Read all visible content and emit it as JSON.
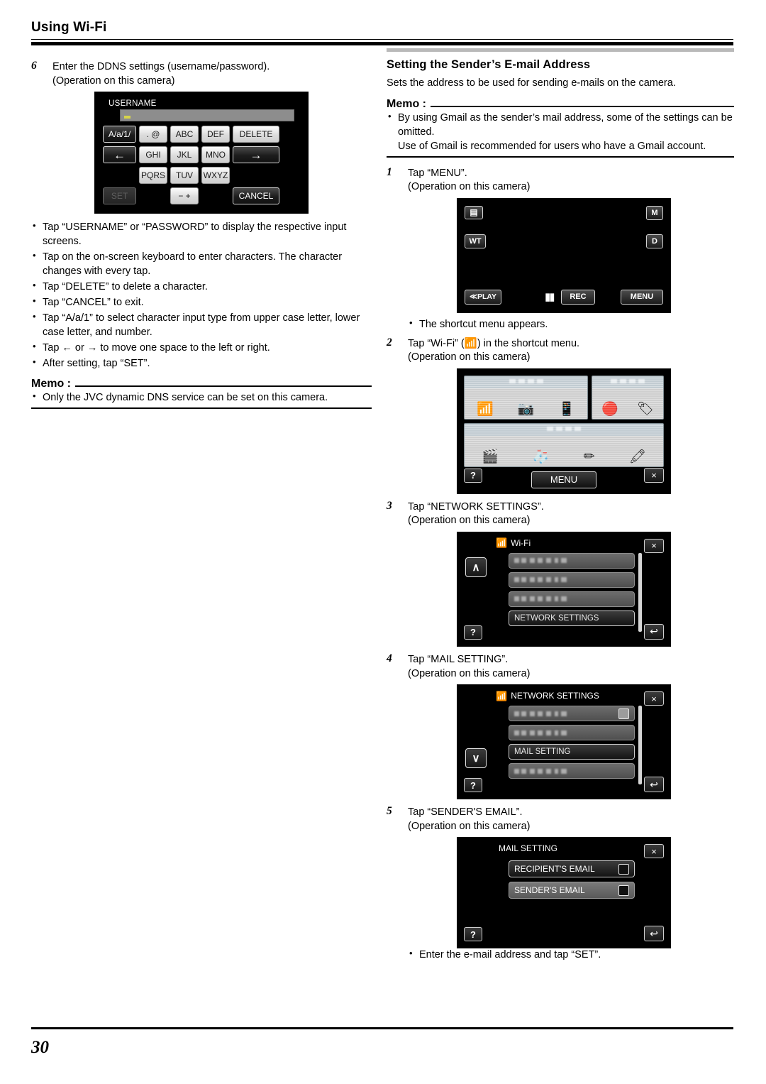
{
  "header": {
    "title": "Using Wi-Fi"
  },
  "footer": {
    "page_number": "30"
  },
  "left_column": {
    "step6": {
      "number": "6",
      "line1": "Enter the DDNS settings (username/password).",
      "line2": "(Operation on this camera)"
    },
    "keyboard_screen": {
      "title": "USERNAME",
      "keys": {
        "case_toggle": "A/a/1/",
        "dot_at": ". @",
        "abc": "ABC",
        "def": "DEF",
        "delete": "DELETE",
        "left_arrow": "←",
        "ghi": "GHI",
        "jkl": "JKL",
        "mno": "MNO",
        "right_arrow": "→",
        "pqrs": "PQRS",
        "tuv": "TUV",
        "wxyz": "WXYZ",
        "set": "SET",
        "minus_plus": "− +",
        "cancel": "CANCEL"
      }
    },
    "bullets": [
      {
        "text": "Tap “USERNAME” or “PASSWORD” to display the respective input screens."
      },
      {
        "text": "Tap on the on-screen keyboard to enter characters. The character changes with every tap."
      },
      {
        "text": "Tap “DELETE” to delete a character."
      },
      {
        "text": "Tap “CANCEL” to exit."
      },
      {
        "text": "Tap “A/a/1” to select character input type from upper case letter, lower case letter, and number."
      },
      {
        "text": "Tap ← or → to move one space to the left or right."
      },
      {
        "text": "After setting, tap “SET”."
      }
    ],
    "memo": {
      "label": "Memo :",
      "items": [
        "Only the JVC dynamic DNS service can be set on this camera."
      ]
    }
  },
  "right_column": {
    "section_title": "Setting the Sender’s E-mail Address",
    "section_desc": "Sets the address to be used for sending e-mails on the camera.",
    "memo": {
      "label": "Memo :",
      "items": [
        "By using Gmail as the sender’s mail address, some of the settings can be omitted.",
        "Use of Gmail is recommended for users who have a Gmail account."
      ]
    },
    "steps": [
      {
        "number": "1",
        "line1": "Tap “MENU”.",
        "line2": "(Operation on this camera)",
        "note": "The shortcut menu appears."
      },
      {
        "number": "2",
        "line1": "Tap “Wi-Fi” (\u0001) in the shortcut menu.",
        "line1_pre": "Tap “Wi-Fi” (",
        "line1_post": ") in the shortcut menu.",
        "line2": "(Operation on this camera)"
      },
      {
        "number": "3",
        "line1": "Tap “NETWORK SETTINGS”.",
        "line2": "(Operation on this camera)"
      },
      {
        "number": "4",
        "line1": "Tap “MAIL SETTING”.",
        "line2": "(Operation on this camera)"
      },
      {
        "number": "5",
        "line1": "Tap “SENDER'S EMAIL”.",
        "line2": "(Operation on this camera)",
        "note": "Enter the e-mail address and tap “SET”."
      }
    ],
    "rec_screen": {
      "camera_mode": "▤",
      "m_label": "M",
      "wt_label": "WT",
      "d_label": "D",
      "play_label": "≪PLAY",
      "rec_label": "REC",
      "menu_label": "MENU"
    },
    "shortcut_screen": {
      "menu_label": "MENU",
      "help_label": "?",
      "close_label": "×",
      "icons_row1_panel1": [
        "wifi-icon",
        "camera-to-paper-icon",
        "camera-to-phone-icon"
      ],
      "icons_row1_panel2": [
        "record-off-icon",
        "name-tag-icon"
      ],
      "icons_row2": [
        "clapperboard-icon",
        "glasses-mustache-icon",
        "pencils-icon",
        "stamp-icon"
      ]
    },
    "wifi_screen": {
      "title": "Wi-Fi",
      "rows": [
        "",
        "",
        ""
      ],
      "selected_row": "NETWORK SETTINGS",
      "help_label": "?",
      "close_label": "×",
      "back_label": "↩",
      "up_label": "∧"
    },
    "network_settings_screen": {
      "title": "NETWORK SETTINGS",
      "rows": [
        "",
        "",
        ""
      ],
      "selected_row": "MAIL SETTING",
      "help_label": "?",
      "close_label": "×",
      "back_label": "↩",
      "down_label": "∨"
    },
    "mail_setting_screen": {
      "title": "MAIL SETTING",
      "rows": [
        {
          "label": "RECIPIENT'S EMAIL",
          "selected": true
        },
        {
          "label": "SENDER'S EMAIL",
          "selected": false
        }
      ],
      "help_label": "?",
      "close_label": "×",
      "back_label": "↩"
    }
  }
}
